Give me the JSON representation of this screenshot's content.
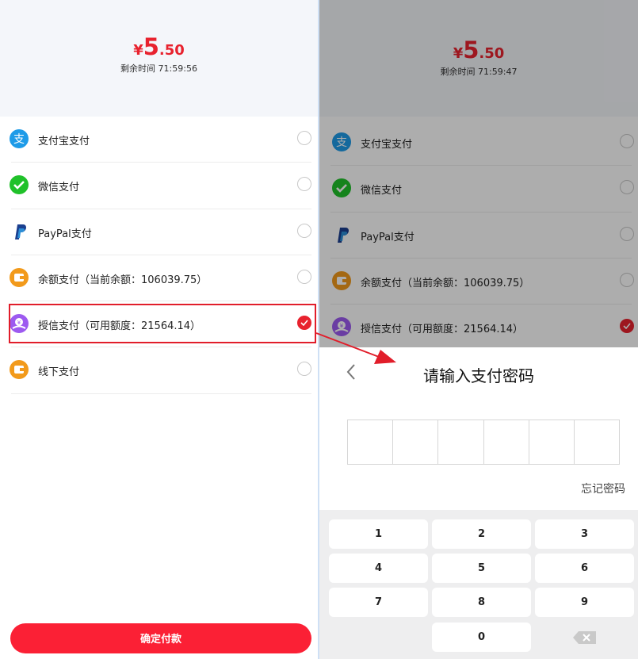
{
  "left": {
    "price": {
      "symbol": "¥",
      "integer": "5",
      "decimal": ".50"
    },
    "countdown": "剩余时间  71:59:56",
    "methods": [
      {
        "label": "支付宝支付",
        "icon": "alipay-icon",
        "selected": false
      },
      {
        "label": "微信支付",
        "icon": "wechat-icon",
        "selected": false
      },
      {
        "label": "PayPal支付",
        "icon": "paypal-icon",
        "selected": false
      },
      {
        "label": "余额支付（当前余额：106039.75）",
        "icon": "wallet-icon",
        "selected": false
      },
      {
        "label": "授信支付（可用额度：21564.14）",
        "icon": "credit-icon",
        "selected": true
      },
      {
        "label": "线下支付",
        "icon": "wallet-icon",
        "selected": false
      }
    ],
    "confirm_label": "确定付款"
  },
  "right": {
    "price": {
      "symbol": "¥",
      "integer": "5",
      "decimal": ".50"
    },
    "countdown": "剩余时间  71:59:47",
    "methods": [
      {
        "label": "支付宝支付"
      },
      {
        "label": "微信支付"
      },
      {
        "label": "PayPal支付"
      },
      {
        "label": "余额支付（当前余额：106039.75）"
      },
      {
        "label": "授信支付（可用额度：21564.14）"
      }
    ],
    "sheet": {
      "title": "请输入支付密码",
      "forgot_label": "忘记密码",
      "keys": [
        "1",
        "2",
        "3",
        "4",
        "5",
        "6",
        "7",
        "8",
        "9",
        "0"
      ]
    }
  },
  "colors": {
    "accent": "#e8222e",
    "confirm": "#fb2035",
    "alipay": "#1e9be8",
    "wechat": "#20c12a",
    "balance": "#f29a1b",
    "credit": "#9d5af0"
  }
}
